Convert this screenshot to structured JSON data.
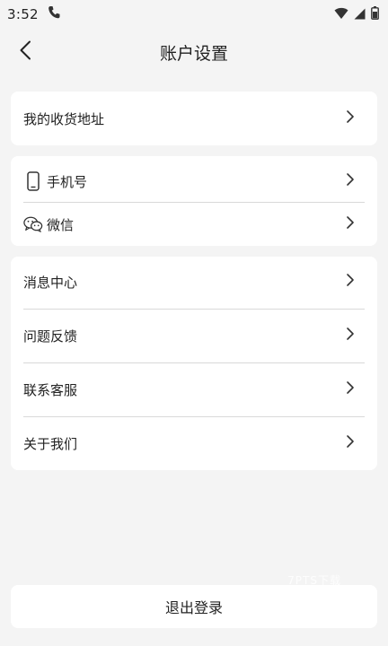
{
  "status_bar": {
    "time": "3:52",
    "icons": [
      "phone-icon",
      "wifi-icon",
      "signal-icon",
      "battery-icon"
    ]
  },
  "header": {
    "title": "账户设置",
    "back_icon": "chevron-left-icon"
  },
  "sections": {
    "address": {
      "label": "我的收货地址"
    },
    "account": {
      "phone": {
        "label": "手机号",
        "icon": "mobile-phone-icon"
      },
      "wechat": {
        "label": "微信",
        "icon": "wechat-icon"
      }
    },
    "misc": {
      "messages": {
        "label": "消息中心"
      },
      "feedback": {
        "label": "问题反馈"
      },
      "support": {
        "label": "联系客服"
      },
      "about": {
        "label": "关于我们"
      }
    }
  },
  "logout": {
    "label": "退出登录"
  },
  "watermark": {
    "text": "7PTS下载"
  },
  "colors": {
    "background": "#f4f4f4",
    "card": "#ffffff",
    "divider": "#d9d9d9",
    "text": "#222222"
  }
}
